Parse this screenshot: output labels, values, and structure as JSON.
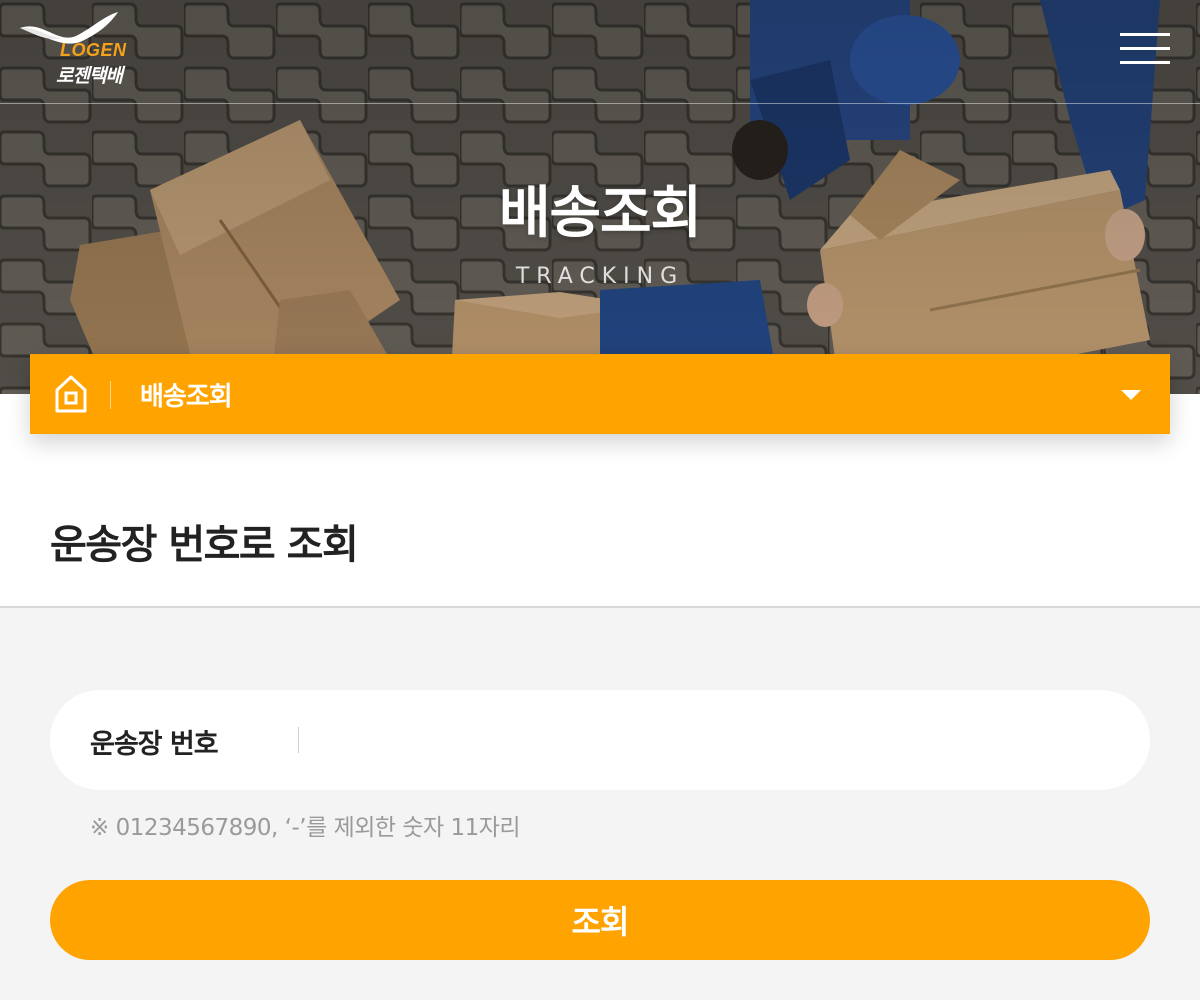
{
  "header": {
    "logo_en": "LOGEN",
    "logo_ko": "로젠택배",
    "menu_icon": "hamburger-icon"
  },
  "hero": {
    "title": "배송조회",
    "subtitle": "TRACKING"
  },
  "breadcrumb": {
    "home_icon": "home-icon",
    "current": "배송조회",
    "dropdown_icon": "caret-down-icon"
  },
  "section": {
    "title": "운송장 번호로 조회"
  },
  "form": {
    "label": "운송장 번호",
    "value": "",
    "placeholder": "",
    "hint": "※ 01234567890, ‘-’를 제외한 숫자 11자리",
    "submit_label": "조회"
  },
  "colors": {
    "accent": "#ffa300",
    "logo_orange": "#f4a11c",
    "background": "#f4f4f4"
  }
}
